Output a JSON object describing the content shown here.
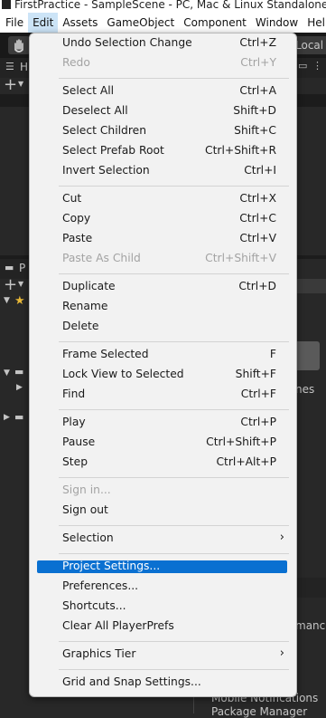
{
  "window": {
    "title": "FirstPractice - SampleScene - PC, Mac & Linux Standalone - U"
  },
  "menubar": [
    "File",
    "Edit",
    "Assets",
    "GameObject",
    "Component",
    "Window",
    "Help"
  ],
  "toolbar": {
    "pivot_label": "Local"
  },
  "panel_labels": {
    "hierarchy_tab": "H",
    "project_tab": "P",
    "scenes_text": "nes",
    "mance_text": "mance",
    "mobile_notifications": "Mobile Notifications",
    "package_manager": "Package Manager"
  },
  "edit_menu": [
    {
      "label": "Undo Selection Change",
      "shortcut": "Ctrl+Z"
    },
    {
      "label": "Redo",
      "shortcut": "Ctrl+Y",
      "disabled": true
    },
    {
      "label": "Select All",
      "shortcut": "Ctrl+A"
    },
    {
      "label": "Deselect All",
      "shortcut": "Shift+D"
    },
    {
      "label": "Select Children",
      "shortcut": "Shift+C"
    },
    {
      "label": "Select Prefab Root",
      "shortcut": "Ctrl+Shift+R"
    },
    {
      "label": "Invert Selection",
      "shortcut": "Ctrl+I"
    },
    {
      "label": "Cut",
      "shortcut": "Ctrl+X"
    },
    {
      "label": "Copy",
      "shortcut": "Ctrl+C"
    },
    {
      "label": "Paste",
      "shortcut": "Ctrl+V"
    },
    {
      "label": "Paste As Child",
      "shortcut": "Ctrl+Shift+V",
      "disabled": true
    },
    {
      "label": "Duplicate",
      "shortcut": "Ctrl+D"
    },
    {
      "label": "Rename",
      "shortcut": ""
    },
    {
      "label": "Delete",
      "shortcut": ""
    },
    {
      "label": "Frame Selected",
      "shortcut": "F"
    },
    {
      "label": "Lock View to Selected",
      "shortcut": "Shift+F"
    },
    {
      "label": "Find",
      "shortcut": "Ctrl+F"
    },
    {
      "label": "Play",
      "shortcut": "Ctrl+P"
    },
    {
      "label": "Pause",
      "shortcut": "Ctrl+Shift+P"
    },
    {
      "label": "Step",
      "shortcut": "Ctrl+Alt+P"
    },
    {
      "label": "Sign in...",
      "shortcut": "",
      "disabled": true
    },
    {
      "label": "Sign out",
      "shortcut": ""
    },
    {
      "label": "Selection",
      "shortcut": "",
      "submenu": true
    },
    {
      "label": "Project Settings...",
      "shortcut": "",
      "highlighted": true
    },
    {
      "label": "Preferences...",
      "shortcut": ""
    },
    {
      "label": "Shortcuts...",
      "shortcut": ""
    },
    {
      "label": "Clear All PlayerPrefs",
      "shortcut": ""
    },
    {
      "label": "Graphics Tier",
      "shortcut": "",
      "submenu": true
    },
    {
      "label": "Grid and Snap Settings...",
      "shortcut": ""
    }
  ],
  "icons": {
    "submenu_arrow": "chevron-right-icon",
    "hand_tool": "hand-icon",
    "add": "plus-icon"
  }
}
